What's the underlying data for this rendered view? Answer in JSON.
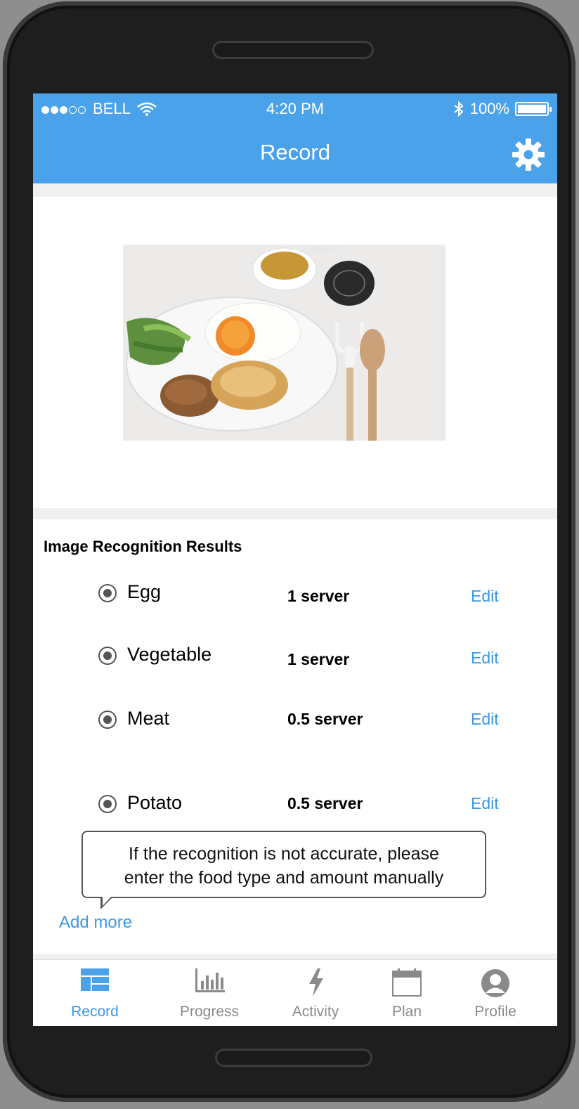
{
  "status_bar": {
    "carrier": "BELL",
    "time": "4:20 PM",
    "battery": "100%",
    "signal_dots_filled": 3,
    "signal_dots_total": 5
  },
  "header": {
    "title": "Record",
    "settings_icon": "gear-icon"
  },
  "results": {
    "title": "Image Recognition Results",
    "items": [
      {
        "name": "Egg",
        "amount": "1 server",
        "edit": "Edit",
        "selected": true
      },
      {
        "name": "Vegetable",
        "amount": "1 server",
        "edit": "Edit",
        "selected": true
      },
      {
        "name": "Meat",
        "amount": "0.5 server",
        "edit": "Edit",
        "selected": true
      },
      {
        "name": "Potato",
        "amount": "0.5 server",
        "edit": "Edit",
        "selected": true
      }
    ],
    "tooltip_line1": "If the recognition is not accurate, please",
    "tooltip_line2": "enter the food type and amount manually",
    "add_more": "Add more"
  },
  "tabs": [
    {
      "label": "Record",
      "icon": "dashboard-icon",
      "active": true
    },
    {
      "label": "Progress",
      "icon": "bar-chart-icon",
      "active": false
    },
    {
      "label": "Activity",
      "icon": "lightning-icon",
      "active": false
    },
    {
      "label": "Plan",
      "icon": "calendar-icon",
      "active": false
    },
    {
      "label": "Profile",
      "icon": "user-icon",
      "active": false
    }
  ],
  "colors": {
    "accent": "#4aa3ea",
    "link": "#3a97e6",
    "inactive_tab": "#8a8a8a"
  }
}
